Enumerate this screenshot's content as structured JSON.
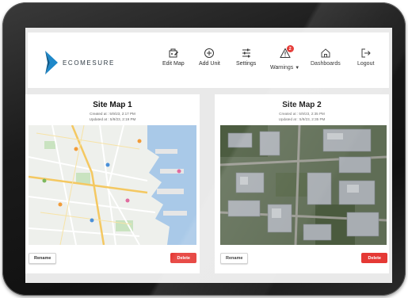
{
  "brand": {
    "name": "ECOMESURE"
  },
  "nav": [
    {
      "label": "Edit Map",
      "icon": "edit-map-icon"
    },
    {
      "label": "Add Unit",
      "icon": "add-circle-icon"
    },
    {
      "label": "Settings",
      "icon": "sliders-icon"
    },
    {
      "label": "Warnings",
      "icon": "warning-triangle-icon",
      "badge": "2"
    },
    {
      "label": "Dashboards",
      "icon": "home-icon"
    },
    {
      "label": "Logout",
      "icon": "logout-icon"
    }
  ],
  "cards": [
    {
      "title": "Site Map 1",
      "created": "Created at : 5/9/23, 2:17 PM",
      "updated": "Updated at : 5/9/23, 2:19 PM",
      "map_kind": "street-map",
      "rename_label": "Rename",
      "delete_label": "Delete"
    },
    {
      "title": "Site Map 2",
      "created": "Created at : 5/9/23, 2:35 PM",
      "updated": "Updated at : 5/9/23, 2:35 PM",
      "map_kind": "satellite-map",
      "rename_label": "Rename",
      "delete_label": "Delete"
    }
  ],
  "colors": {
    "accent_red": "#e53935",
    "logo_blue": "#1e88c9",
    "screen_bg": "#e9e9e9"
  }
}
